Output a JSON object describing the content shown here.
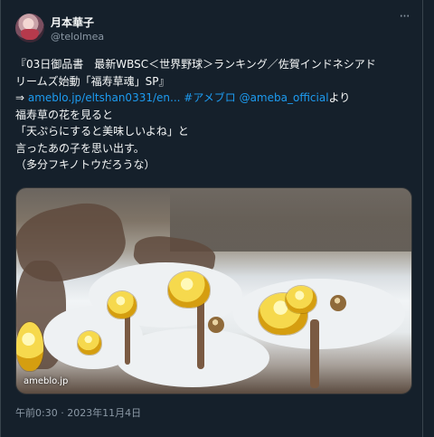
{
  "author": {
    "display_name": "月本華子",
    "handle": "@telolmea"
  },
  "more_icon": "more-horizontal-icon",
  "tweet": {
    "line1": "『03日御品書　最新WBSC＜世界野球＞ランキング／佐賀インドネシアド",
    "line2": "リームズ始動「福寿草魂」SP』",
    "arrow": "⇒ ",
    "link_url": "ameblo.jp/eltshan0331/en...",
    "space": " ",
    "hashtag": "#アメブロ",
    "space2": " ",
    "mention": "@ameba_official",
    "suffix": "より",
    "line4": "福寿草の花を見ると",
    "line5": "「天ぷらにすると美味しいよね」と",
    "line6": "言ったあの子を思い出す。",
    "line7": "（多分フキノトウだろうな）"
  },
  "media": {
    "source_label": "ameblo.jp"
  },
  "timestamp": "午前0:30 · 2023年11月4日",
  "colors": {
    "background": "#15202b",
    "text": "#f7f9f9",
    "secondary": "#8b98a5",
    "accent": "#1d9bf0"
  }
}
